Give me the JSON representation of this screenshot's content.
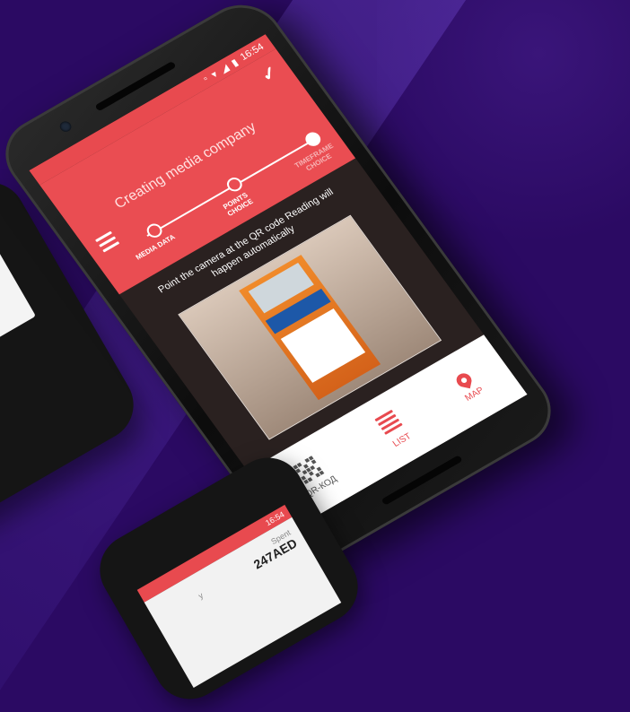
{
  "background": {
    "color": "#2b0a63",
    "accent": "#ea4d52"
  },
  "main_phone": {
    "status": {
      "time": "16:54",
      "icons": [
        "vibrate-icon",
        "wifi-icon",
        "signal-icon",
        "battery-icon"
      ]
    },
    "header": {
      "title": "Creating media company",
      "steps": [
        {
          "label": "MEDIA DATA"
        },
        {
          "label": "POINTS CHOICE"
        },
        {
          "label": "TIMEFRAME CHOICE"
        }
      ]
    },
    "hint": "Point the camera at the QR code Reading will happen automatically",
    "tabs": [
      {
        "label": "QR-КОД",
        "icon": "qr-icon"
      },
      {
        "label": "LIST",
        "icon": "list-icon"
      },
      {
        "label": "MAP",
        "icon": "map-pin-icon"
      }
    ]
  },
  "second_phone": {
    "time": "16:54",
    "day_label": "y",
    "spent_label": "Spent",
    "spent_value": "247AED"
  }
}
